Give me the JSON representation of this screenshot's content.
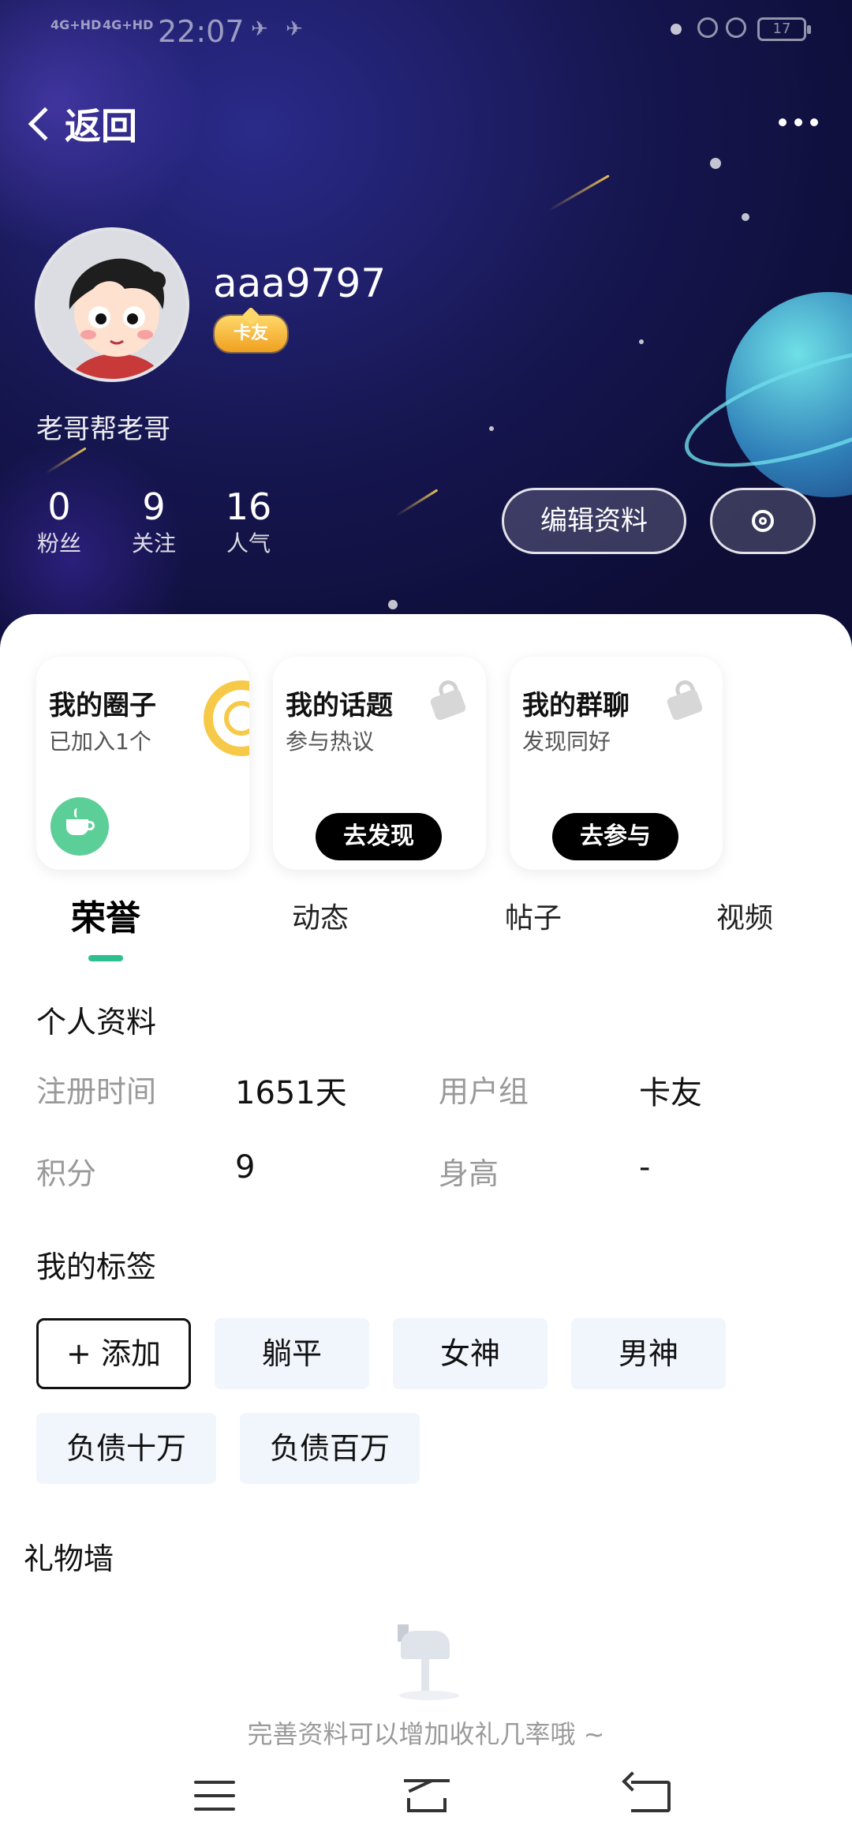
{
  "status_bar": {
    "signal_1": "4G+HD",
    "signal_2": "4G+HD",
    "time": "22:07",
    "battery": "17"
  },
  "nav": {
    "back_label": "返回",
    "more_icon": "more-icon"
  },
  "profile": {
    "username": "aaa9797",
    "badge": "卡友",
    "motto": "老哥帮老哥",
    "stats": [
      {
        "value": "0",
        "label": "粉丝"
      },
      {
        "value": "9",
        "label": "关注"
      },
      {
        "value": "16",
        "label": "人气"
      }
    ],
    "edit_label": "编辑资料",
    "settings_icon": "gear-icon"
  },
  "cards": [
    {
      "title": "我的圈子",
      "subtitle": "已加入1个",
      "icon": "coffee-cup-icon"
    },
    {
      "title": "我的话题",
      "subtitle": "参与热议",
      "button": "去发现",
      "icon": "lock-icon"
    },
    {
      "title": "我的群聊",
      "subtitle": "发现同好",
      "button": "去参与",
      "icon": "lock-icon"
    }
  ],
  "tabs": [
    {
      "label": "荣誉",
      "active": true
    },
    {
      "label": "动态",
      "active": false
    },
    {
      "label": "帖子",
      "active": false
    },
    {
      "label": "视频",
      "active": false
    }
  ],
  "personal_info": {
    "title": "个人资料",
    "rows": [
      {
        "label1": "注册时间",
        "value1": "1651天",
        "label2": "用户组",
        "value2": "卡友"
      },
      {
        "label1": "积分",
        "value1": "9",
        "label2": "身高",
        "value2": "-"
      }
    ]
  },
  "tags": {
    "title": "我的标签",
    "add_label": "+ 添加",
    "items": [
      "躺平",
      "女神",
      "男神",
      "负债十万",
      "负债百万"
    ]
  },
  "gift_wall": {
    "title": "礼物墙",
    "empty_text": "完善资料可以增加收礼几率哦 ~"
  },
  "colors": {
    "accent": "#2cbf8f",
    "hero_bg": "#161650",
    "tag_bg": "#f1f5fc"
  }
}
